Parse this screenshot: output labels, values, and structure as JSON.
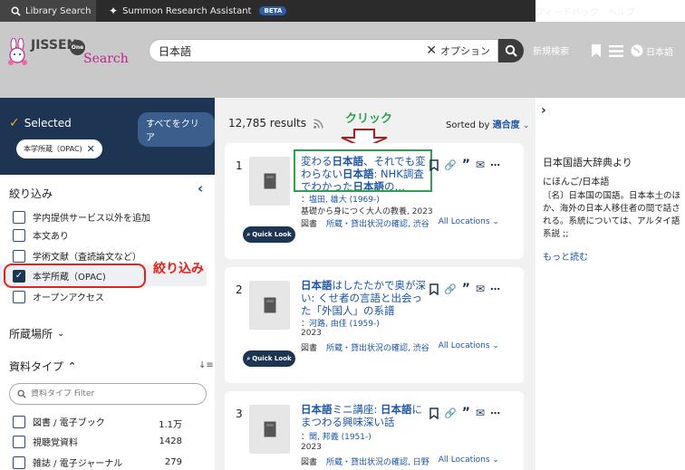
{
  "topbar": {
    "library_search": "Library Search",
    "summon_ra": "Summon Research Assistant",
    "beta": "BETA",
    "feedback": "フィードバック",
    "help": "ヘルプ"
  },
  "header": {
    "logo_jissen": "JISSEN",
    "logo_one": "One",
    "logo_search": "Search",
    "search_value": "日本語",
    "clear": "✕",
    "options": "オプション",
    "new_search": "新規検索",
    "language": "日本語"
  },
  "left": {
    "selected_title": "Selected",
    "clear_all": "すべてをクリア",
    "chip_label": "本学所蔵（OPAC)",
    "refine_title": "絞り込み",
    "options": [
      {
        "label": "学内提供サービス以外を追加",
        "checked": false
      },
      {
        "label": "本文あり",
        "checked": false
      },
      {
        "label": "学術文献（査読論文など）",
        "checked": false
      },
      {
        "label": "本学所蔵（OPAC)",
        "checked": true
      },
      {
        "label": "オープンアクセス",
        "checked": false
      }
    ],
    "annotation": "絞り込み",
    "location_title": "所蔵場所",
    "material_type_title": "資料タイプ",
    "filter_placeholder": "資料タイプ Filter",
    "types": [
      {
        "label": "図書 / 電子ブック",
        "count": "1.1万"
      },
      {
        "label": "視聴覚資料",
        "count": "1428"
      },
      {
        "label": "雑誌 / 電子ジャーナル",
        "count": "279"
      }
    ]
  },
  "results": {
    "count": "12,785 results",
    "sort_prefix": "Sorted by",
    "sort_value": "適合度",
    "annotation": "クリック",
    "quick_look": "Quick Look",
    "all_locations": "All Locations",
    "items": [
      {
        "num": "1",
        "title_parts": [
          "変わる",
          "日本語",
          "、それでも変わらない",
          "日本語",
          ": NHK調査でわかった",
          "日本語",
          "の…"
        ],
        "author_prefix": "：",
        "author": "塩田, 雄大 (1969-)",
        "extra": "基礎から身につく大人の教養, 2023",
        "type": "図書",
        "status": "所蔵・貸出状況の確認, 渋谷"
      },
      {
        "num": "2",
        "title_parts": [
          "日本語",
          "はしたたかで奥が深い: くせ者の言語と出会った「外国人」の系譜"
        ],
        "author_prefix": "：",
        "author": "河路, 由佳 (1959-)",
        "extra": "2023",
        "type": "図書",
        "status": "所蔵・貸出状況の確認, 渋谷"
      },
      {
        "num": "3",
        "title_parts": [
          "日本語",
          "ミニ講座: ",
          "日本語",
          "にまつわる興味深い話"
        ],
        "author_prefix": "：",
        "author": "関, 邦義 (1951-)",
        "extra": "2023",
        "type": "図書",
        "status": "所蔵・貸出状況の確認, 日野"
      }
    ]
  },
  "right": {
    "dict_title": "日本国語大辞典より",
    "reading": "にほんご/日本語",
    "description": "〔名〕日本国の国語。日本本土のほか、海外の日本人移住者の間で話される。系統については、アルタイ語系説 ;;",
    "more": "もっと読む"
  },
  "colors": {
    "navy": "#1d3553",
    "link": "#1a56a5",
    "annotation_red": "#e2231a",
    "annotation_green": "#2ca24e",
    "check_orange": "#f5a623"
  }
}
